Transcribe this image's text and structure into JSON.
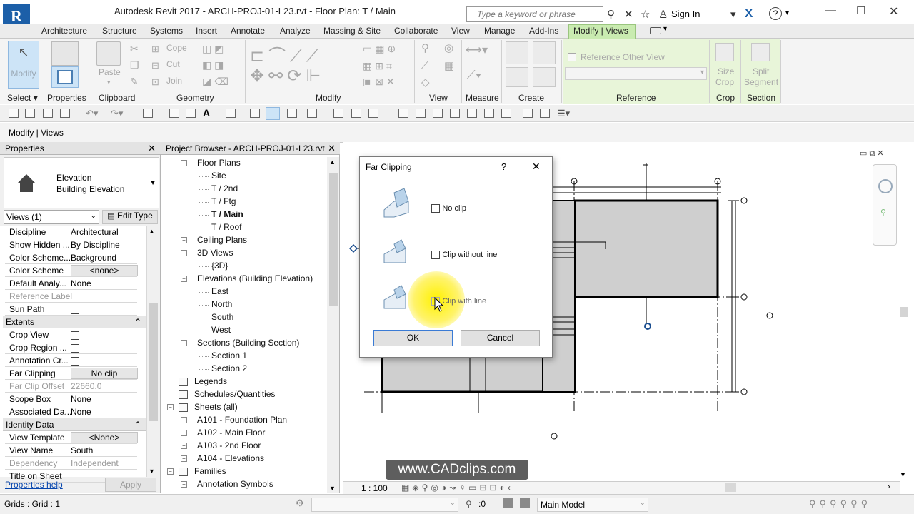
{
  "app": {
    "logo": "R",
    "title": "Autodesk Revit 2017 -     ARCH-PROJ-01-L23.rvt - Floor Plan: T / Main",
    "search_placeholder": "Type a keyword or phrase",
    "sign_in": "Sign In"
  },
  "tabs": [
    "Architecture",
    "Structure",
    "Systems",
    "Insert",
    "Annotate",
    "Analyze",
    "Massing & Site",
    "Collaborate",
    "View",
    "Manage",
    "Add-Ins",
    "Modify | Views"
  ],
  "ribbon": {
    "modify": "Modify",
    "paste": "Paste",
    "cope": "Cope",
    "cut": "Cut",
    "join": "Join",
    "reference_other_view": "Reference Other View",
    "size_crop_1": "Size",
    "size_crop_2": "Crop",
    "split_segment_1": "Split",
    "split_segment_2": "Segment",
    "panels": [
      "Select",
      "Properties",
      "Clipboard",
      "Geometry",
      "Modify",
      "View",
      "Measure",
      "Create",
      "Reference",
      "Crop",
      "Section"
    ]
  },
  "options_bar": {
    "label": "Modify | Views"
  },
  "properties": {
    "header": "Properties",
    "type_name_1": "Elevation",
    "type_name_2": "Building Elevation",
    "selector": "Views (1)",
    "edit_type": "Edit Type",
    "rows": [
      {
        "k": "Discipline",
        "v": "Architectural"
      },
      {
        "k": "Show Hidden ...",
        "v": "By Discipline"
      },
      {
        "k": "Color Scheme...",
        "v": "Background"
      },
      {
        "k": "Color Scheme",
        "v": "<none>"
      },
      {
        "k": "Default Analy...",
        "v": "None"
      },
      {
        "k": "Reference Label",
        "v": ""
      },
      {
        "k": "Sun Path",
        "v": ""
      }
    ],
    "extents_label": "Extents",
    "extents_rows": [
      {
        "k": "Crop View",
        "v": ""
      },
      {
        "k": "Crop Region ...",
        "v": ""
      },
      {
        "k": "Annotation Cr...",
        "v": ""
      },
      {
        "k": "Far Clipping",
        "v": "No clip"
      },
      {
        "k": "Far Clip Offset",
        "v": "22660.0"
      },
      {
        "k": "Scope Box",
        "v": "None"
      },
      {
        "k": "Associated Da...",
        "v": "None"
      }
    ],
    "identity_label": "Identity Data",
    "identity_rows": [
      {
        "k": "View Template",
        "v": "<None>"
      },
      {
        "k": "View Name",
        "v": "South"
      },
      {
        "k": "Dependency",
        "v": "Independent"
      },
      {
        "k": "Title on Sheet",
        "v": ""
      }
    ],
    "help": "Properties help",
    "apply": "Apply"
  },
  "browser": {
    "header": "Project Browser - ARCH-PROJ-01-L23.rvt",
    "items": [
      {
        "label": "Floor Plans",
        "level": 1,
        "exp": "−"
      },
      {
        "label": "Site",
        "level": 2
      },
      {
        "label": "T / 2nd",
        "level": 2
      },
      {
        "label": "T / Ftg",
        "level": 2
      },
      {
        "label": "T / Main",
        "level": 2,
        "bold": true
      },
      {
        "label": "T / Roof",
        "level": 2
      },
      {
        "label": "Ceiling Plans",
        "level": 1,
        "exp": "+"
      },
      {
        "label": "3D Views",
        "level": 1,
        "exp": "−"
      },
      {
        "label": "{3D}",
        "level": 2
      },
      {
        "label": "Elevations (Building Elevation)",
        "level": 1,
        "exp": "−"
      },
      {
        "label": "East",
        "level": 2
      },
      {
        "label": "North",
        "level": 2
      },
      {
        "label": "South",
        "level": 2
      },
      {
        "label": "West",
        "level": 2
      },
      {
        "label": "Sections (Building Section)",
        "level": 1,
        "exp": "−"
      },
      {
        "label": "Section 1",
        "level": 2
      },
      {
        "label": "Section 2",
        "level": 2
      },
      {
        "label": "Legends",
        "level": 0
      },
      {
        "label": "Schedules/Quantities",
        "level": 0
      },
      {
        "label": "Sheets (all)",
        "level": 0,
        "exp": "−"
      },
      {
        "label": "A101 - Foundation Plan",
        "level": 1,
        "exp": "+"
      },
      {
        "label": "A102 - Main Floor",
        "level": 1,
        "exp": "+"
      },
      {
        "label": "A103 - 2nd Floor",
        "level": 1,
        "exp": "+"
      },
      {
        "label": "A104 - Elevations",
        "level": 1,
        "exp": "+"
      },
      {
        "label": "Families",
        "level": 0,
        "exp": "−"
      },
      {
        "label": "Annotation Symbols",
        "level": 1,
        "exp": "+"
      }
    ]
  },
  "dialog": {
    "title": "Far Clipping",
    "help": "?",
    "close": "✕",
    "options": [
      "No clip",
      "Clip without line",
      "Clip with line"
    ],
    "ok": "OK",
    "cancel": "Cancel"
  },
  "view_bar": {
    "scale": "1 : 100"
  },
  "status": {
    "left": "Grids : Grid : 1",
    "zero": ":0",
    "model": "Main Model"
  },
  "watermark": "www.CADclips.com"
}
